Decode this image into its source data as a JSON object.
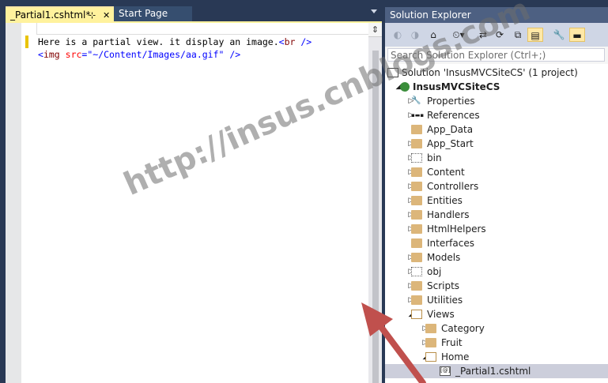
{
  "document_tabs": {
    "active": {
      "label": "_Partial1.cshtml*",
      "pin_glyph": "⊹",
      "close_glyph": "✕"
    },
    "inactive": {
      "label": "Start Page"
    }
  },
  "editor": {
    "code_lines": [
      [
        {
          "text": "Here is a partial view. it display an image.",
          "color": "#000000"
        },
        {
          "text": "<",
          "color": "#0000FF"
        },
        {
          "text": "br",
          "color": "#800000"
        },
        {
          "text": " />",
          "color": "#0000FF"
        }
      ],
      [
        {
          "text": "<",
          "color": "#0000FF"
        },
        {
          "text": "img",
          "color": "#800000"
        },
        {
          "text": " src",
          "color": "#FF0000"
        },
        {
          "text": "=",
          "color": "#0000FF"
        },
        {
          "text": "\"~/Content/Images/aa.gif\"",
          "color": "#0000FF"
        },
        {
          "text": " />",
          "color": "#0000FF"
        }
      ]
    ],
    "split_glyph": "⇕"
  },
  "solution_explorer": {
    "title": "Solution Explorer",
    "toolbar": [
      {
        "name": "back-icon",
        "glyph": "◐",
        "enabled": false
      },
      {
        "name": "forward-icon",
        "glyph": "◑",
        "enabled": false
      },
      {
        "name": "home-icon",
        "glyph": "⌂",
        "enabled": true
      },
      {
        "name": "pending-changes-icon",
        "glyph": "⏲▾",
        "enabled": true
      },
      {
        "name": "sync-icon",
        "glyph": "⇄",
        "enabled": true
      },
      {
        "name": "refresh-icon",
        "glyph": "⟳",
        "enabled": true
      },
      {
        "name": "collapse-all-icon",
        "glyph": "⧉",
        "enabled": true
      },
      {
        "name": "show-all-files-icon",
        "glyph": "▤",
        "enabled": true,
        "selected": true
      },
      {
        "name": "properties-icon",
        "glyph": "🔧",
        "enabled": true
      },
      {
        "name": "preview-icon",
        "glyph": "▬",
        "enabled": true,
        "selected": true
      }
    ],
    "search_placeholder": "Search Solution Explorer (Ctrl+;)",
    "tree": [
      {
        "label": "Solution 'InsusMVCSiteCS' (1 project)",
        "depth": 0,
        "arrow": "",
        "icon": "solution-icon"
      },
      {
        "label": "InsusMVCSiteCS",
        "depth": 0,
        "arrow": "expanded",
        "icon": "web-project-icon",
        "bold": true
      },
      {
        "label": "Properties",
        "depth": 1,
        "arrow": "collapsed",
        "icon": "wrench-icon"
      },
      {
        "label": "References",
        "depth": 1,
        "arrow": "collapsed",
        "icon": "references-icon"
      },
      {
        "label": "App_Data",
        "depth": 1,
        "arrow": "",
        "icon": "folder-icon"
      },
      {
        "label": "App_Start",
        "depth": 1,
        "arrow": "collapsed",
        "icon": "folder-icon"
      },
      {
        "label": "bin",
        "depth": 1,
        "arrow": "collapsed",
        "icon": "hidden-folder-icon"
      },
      {
        "label": "Content",
        "depth": 1,
        "arrow": "collapsed",
        "icon": "folder-icon"
      },
      {
        "label": "Controllers",
        "depth": 1,
        "arrow": "collapsed",
        "icon": "folder-icon"
      },
      {
        "label": "Entities",
        "depth": 1,
        "arrow": "collapsed",
        "icon": "folder-icon"
      },
      {
        "label": "Handlers",
        "depth": 1,
        "arrow": "collapsed",
        "icon": "folder-icon"
      },
      {
        "label": "HtmlHelpers",
        "depth": 1,
        "arrow": "collapsed",
        "icon": "folder-icon"
      },
      {
        "label": "Interfaces",
        "depth": 1,
        "arrow": "",
        "icon": "folder-icon"
      },
      {
        "label": "Models",
        "depth": 1,
        "arrow": "collapsed",
        "icon": "folder-icon"
      },
      {
        "label": "obj",
        "depth": 1,
        "arrow": "collapsed",
        "icon": "hidden-folder-icon"
      },
      {
        "label": "Scripts",
        "depth": 1,
        "arrow": "collapsed",
        "icon": "folder-icon"
      },
      {
        "label": "Utilities",
        "depth": 1,
        "arrow": "collapsed",
        "icon": "folder-icon"
      },
      {
        "label": "Views",
        "depth": 1,
        "arrow": "expanded",
        "icon": "open-folder-icon"
      },
      {
        "label": "Category",
        "depth": 2,
        "arrow": "collapsed",
        "icon": "folder-icon"
      },
      {
        "label": "Fruit",
        "depth": 2,
        "arrow": "collapsed",
        "icon": "folder-icon"
      },
      {
        "label": "Home",
        "depth": 2,
        "arrow": "expanded",
        "icon": "open-folder-icon"
      },
      {
        "label": "_Partial1.cshtml",
        "depth": 3,
        "arrow": "",
        "icon": "cshtml-file-icon",
        "selected": true
      }
    ]
  },
  "annotation": {
    "watermark": "http://insus.cnblogs.com",
    "arrow_color": "#C0504D"
  }
}
